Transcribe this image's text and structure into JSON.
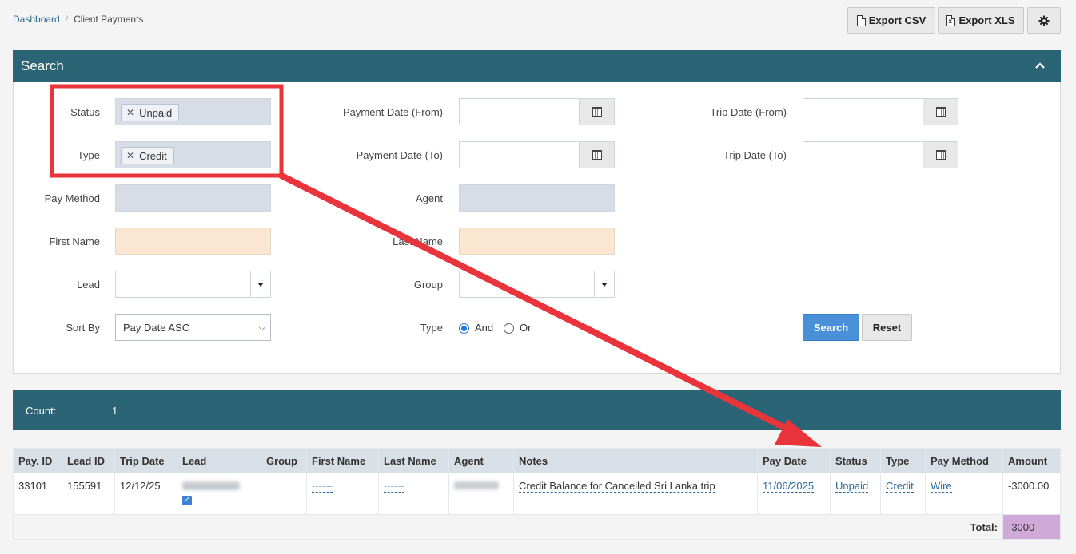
{
  "breadcrumb": {
    "home": "Dashboard",
    "separator": "/",
    "current": "Client Payments"
  },
  "toolbar": {
    "export_csv": "Export CSV",
    "export_xls": "Export XLS"
  },
  "search": {
    "title": "Search",
    "status_label": "Status",
    "status_value": "Unpaid",
    "type_label": "Type",
    "type_value": "Credit",
    "pay_method_label": "Pay Method",
    "first_name_label": "First Name",
    "lead_label": "Lead",
    "sort_by_label": "Sort By",
    "sort_by_value": "Pay Date ASC",
    "payment_date_from_label": "Payment Date (From)",
    "payment_date_to_label": "Payment Date (To)",
    "agent_label": "Agent",
    "last_name_label": "Last Name",
    "group_label": "Group",
    "logic_label": "Type",
    "logic_and": "And",
    "logic_or": "Or",
    "logic_selected": "And",
    "trip_date_from_label": "Trip Date (From)",
    "trip_date_to_label": "Trip Date (To)",
    "search_button": "Search",
    "reset_button": "Reset"
  },
  "results": {
    "count_label": "Count:",
    "count_value": "1"
  },
  "table": {
    "columns": [
      "Pay. ID",
      "Lead ID",
      "Trip Date",
      "Lead",
      "Group",
      "First Name",
      "Last Name",
      "Agent",
      "Notes",
      "Pay Date",
      "Status",
      "Type",
      "Pay Method",
      "Amount"
    ],
    "rows": [
      {
        "pay_id": "33101",
        "lead_id": "155591",
        "trip_date": "12/12/25",
        "first_name": "------",
        "last_name": "------",
        "notes": "Credit Balance for Cancelled Sri Lanka trip",
        "pay_date": "11/06/2025",
        "status": "Unpaid",
        "type": "Credit",
        "pay_method": "Wire",
        "amount": "-3000.00"
      }
    ],
    "total_label": "Total:",
    "total_value": "-3000"
  },
  "colors": {
    "header": "#2b6474",
    "primary": "#4a90d9",
    "annotation": "#e8343a",
    "total_bg": "#cfa9d8"
  }
}
